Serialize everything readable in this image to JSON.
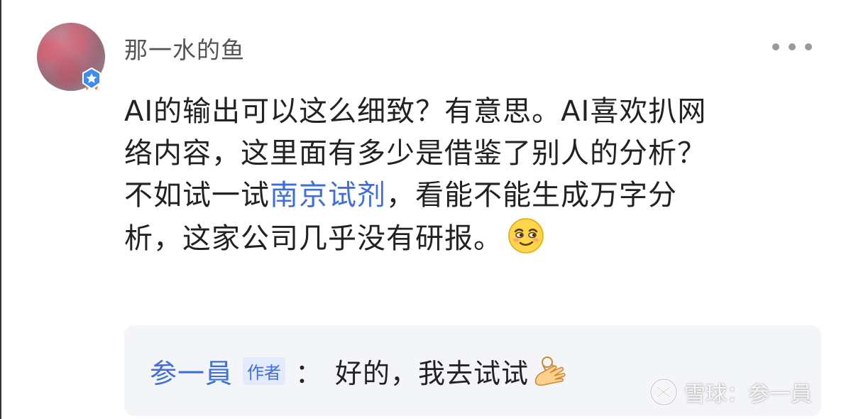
{
  "comment": {
    "username": "那一水的鱼",
    "lines": [
      "AI的输出可以这么细致？有意思。AI喜欢扒网",
      "络内容，这里面有多少是借鉴了别人的分析？"
    ],
    "line3_before": "不如试一试",
    "line3_link": "南京试剂",
    "line3_after": "，看能不能生成万字分",
    "line4": "析，这家公司几乎没有研报。"
  },
  "reply": {
    "author": "参一員",
    "badge": "作者",
    "colon": "：",
    "text": "好的，我去试试"
  },
  "watermark": {
    "text": "雪球：参一員"
  },
  "icons": {
    "verified": "verified-star-badge-icon",
    "more": "more-dots-icon",
    "emoji": "smirk-face-emoji-icon",
    "ok_hand": "ok-hand-emoji-icon",
    "logo": "xueqiu-logo-icon"
  },
  "colors": {
    "link": "#3d6fe0",
    "text": "#222222",
    "username": "#555555",
    "reply_bg": "#f4f5f8"
  }
}
